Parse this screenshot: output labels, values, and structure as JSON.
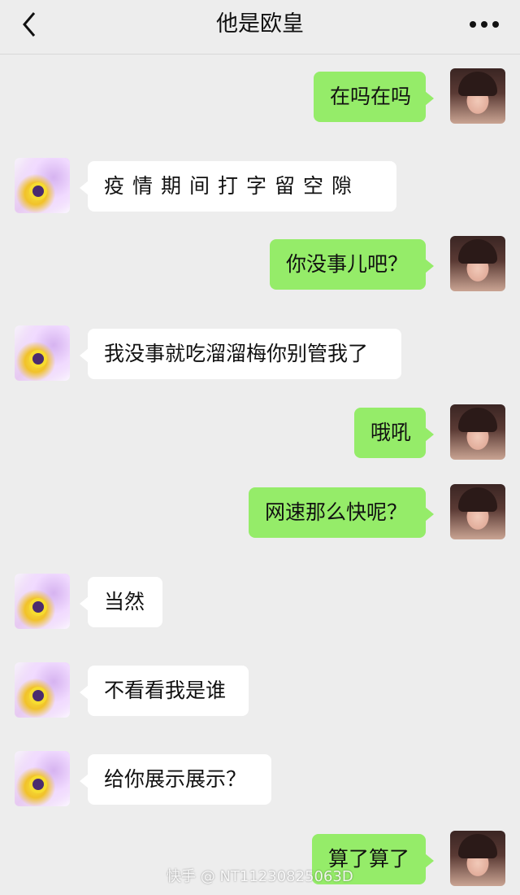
{
  "header": {
    "title": "他是欧皇",
    "back_icon": "chevron-left-icon",
    "more_icon": "more-dots-icon"
  },
  "colors": {
    "background": "#ededed",
    "outgoing_bubble": "#95ec69",
    "incoming_bubble": "#ffffff"
  },
  "messages": [
    {
      "side": "out",
      "text": "在吗在吗"
    },
    {
      "side": "in",
      "text": "疫情期间打字留空隙"
    },
    {
      "side": "out",
      "text": "你没事儿吧？"
    },
    {
      "side": "in",
      "text": "我没事就吃溜溜梅你别管我了"
    },
    {
      "side": "out",
      "text": "哦吼"
    },
    {
      "side": "out",
      "text": "网速那么快呢？"
    },
    {
      "side": "in",
      "text": "当然"
    },
    {
      "side": "in",
      "text": "不看看我是谁"
    },
    {
      "side": "in",
      "text": "给你展示展示？"
    },
    {
      "side": "out",
      "text": "算了算了"
    }
  ],
  "watermark": "快手 @ NT11230825063D"
}
